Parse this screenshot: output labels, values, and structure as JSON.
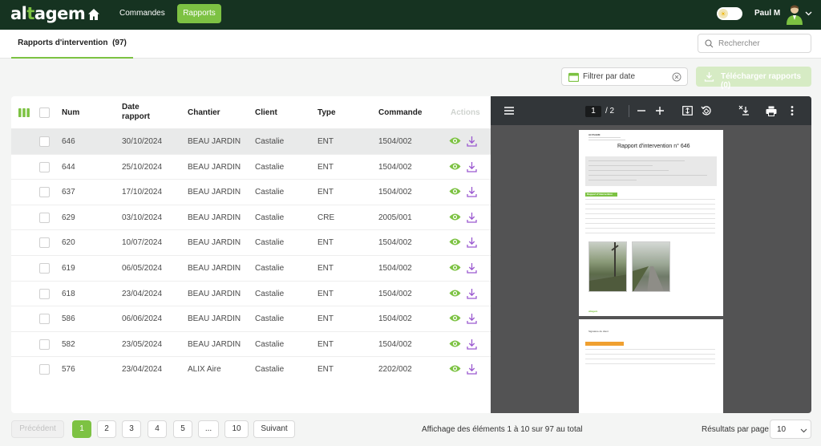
{
  "app": {
    "logo_prefix": "al",
    "logo_accent": "t",
    "logo_suffix": "agem",
    "brand_color": "#7cc242"
  },
  "nav": {
    "home_icon": "home-icon",
    "commandes_label": "Commandes",
    "rapports_label": "Rapports"
  },
  "user": {
    "name": "Paul M",
    "theme_icon": "sun-icon"
  },
  "page": {
    "tab_title": "Rapports d'intervention",
    "tab_count": "(97)",
    "search_placeholder": "Rechercher"
  },
  "actions": {
    "date_filter_placeholder": "Filtrer par date",
    "download_all_label": "Télécharger rapports (0)"
  },
  "table": {
    "columns": {
      "num": "Num",
      "date_line1": "Date",
      "date_line2": "rapport",
      "chantier": "Chantier",
      "client": "Client",
      "type": "Type",
      "commande": "Commande",
      "actions": "Actions"
    },
    "rows": [
      {
        "num": "646",
        "date": "30/10/2024",
        "chantier": "BEAU JARDIN",
        "client": "Castalie",
        "type": "ENT",
        "commande": "1504/002",
        "selected": true
      },
      {
        "num": "644",
        "date": "25/10/2024",
        "chantier": "BEAU JARDIN",
        "client": "Castalie",
        "type": "ENT",
        "commande": "1504/002",
        "selected": false
      },
      {
        "num": "637",
        "date": "17/10/2024",
        "chantier": "BEAU JARDIN",
        "client": "Castalie",
        "type": "ENT",
        "commande": "1504/002",
        "selected": false
      },
      {
        "num": "629",
        "date": "03/10/2024",
        "chantier": "BEAU JARDIN",
        "client": "Castalie",
        "type": "CRE",
        "commande": "2005/001",
        "selected": false
      },
      {
        "num": "620",
        "date": "10/07/2024",
        "chantier": "BEAU JARDIN",
        "client": "Castalie",
        "type": "ENT",
        "commande": "1504/002",
        "selected": false
      },
      {
        "num": "619",
        "date": "06/05/2024",
        "chantier": "BEAU JARDIN",
        "client": "Castalie",
        "type": "ENT",
        "commande": "1504/002",
        "selected": false
      },
      {
        "num": "618",
        "date": "23/04/2024",
        "chantier": "BEAU JARDIN",
        "client": "Castalie",
        "type": "ENT",
        "commande": "1504/002",
        "selected": false
      },
      {
        "num": "586",
        "date": "06/06/2024",
        "chantier": "BEAU JARDIN",
        "client": "Castalie",
        "type": "ENT",
        "commande": "1504/002",
        "selected": false
      },
      {
        "num": "582",
        "date": "23/05/2024",
        "chantier": "BEAU JARDIN",
        "client": "Castalie",
        "type": "ENT",
        "commande": "1504/002",
        "selected": false
      },
      {
        "num": "576",
        "date": "23/04/2024",
        "chantier": "ALIX Aire",
        "client": "Castalie",
        "type": "ENT",
        "commande": "2202/002",
        "selected": false
      }
    ]
  },
  "viewer": {
    "current_page": "1",
    "total_pages": "/ 2",
    "document": {
      "title": "Rapport d'intervention  n° 646",
      "company_line": "ALTAGEM",
      "section_rapport": "Rapport d'intervention",
      "section_signature": "Signature du client",
      "footer_logo": "altagem"
    }
  },
  "pagination": {
    "prev_label": "Précédent",
    "pages": [
      "1",
      "2",
      "3",
      "4",
      "5",
      "...",
      "10"
    ],
    "active_page": "1",
    "next_label": "Suivant",
    "info": "Affichage des éléments 1 à 10 sur 97 au total",
    "per_page_label": "Résultats par page",
    "per_page_value": "10"
  },
  "colors": {
    "topbar": "#163321",
    "accent_green": "#7dc243",
    "action_purple": "#9b59d0",
    "viewer_bg": "#535354"
  }
}
